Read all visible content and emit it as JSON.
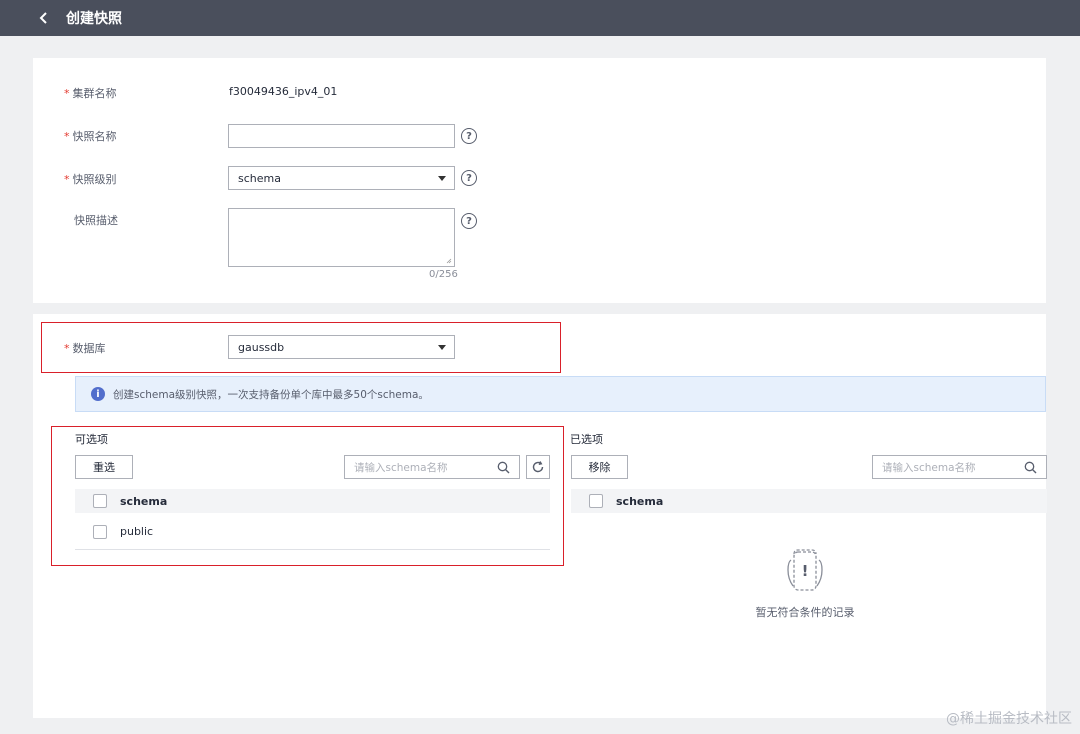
{
  "header": {
    "title": "创建快照"
  },
  "form": {
    "cluster_label": "集群名称",
    "cluster_value": "f30049436_ipv4_01",
    "snapshot_name_label": "快照名称",
    "snapshot_name_value": "",
    "snapshot_level_label": "快照级别",
    "snapshot_level_value": "schema",
    "snapshot_desc_label": "快照描述",
    "snapshot_desc_counter": "0/256",
    "required_mark": "*",
    "help_glyph": "?"
  },
  "database": {
    "label": "数据库",
    "value": "gaussdb"
  },
  "info": {
    "icon_glyph": "i",
    "text": "创建schema级别快照，一次支持备份单个库中最多50个schema。"
  },
  "available": {
    "title": "可选项",
    "reset_label": "重选",
    "search_placeholder": "请输入schema名称",
    "column_header": "schema",
    "rows": [
      "public"
    ]
  },
  "selected": {
    "title": "已选项",
    "remove_label": "移除",
    "search_placeholder": "请输入schema名称",
    "column_header": "schema",
    "empty_text": "暂无符合条件的记录",
    "empty_glyph": "!"
  },
  "watermark": "@稀土掘金技术社区",
  "colors": {
    "header_bg": "#4a4f5c",
    "highlight_border": "#d9202a",
    "info_bg": "#e7f0fc",
    "info_icon": "#526ecc",
    "required": "#e3382e"
  }
}
